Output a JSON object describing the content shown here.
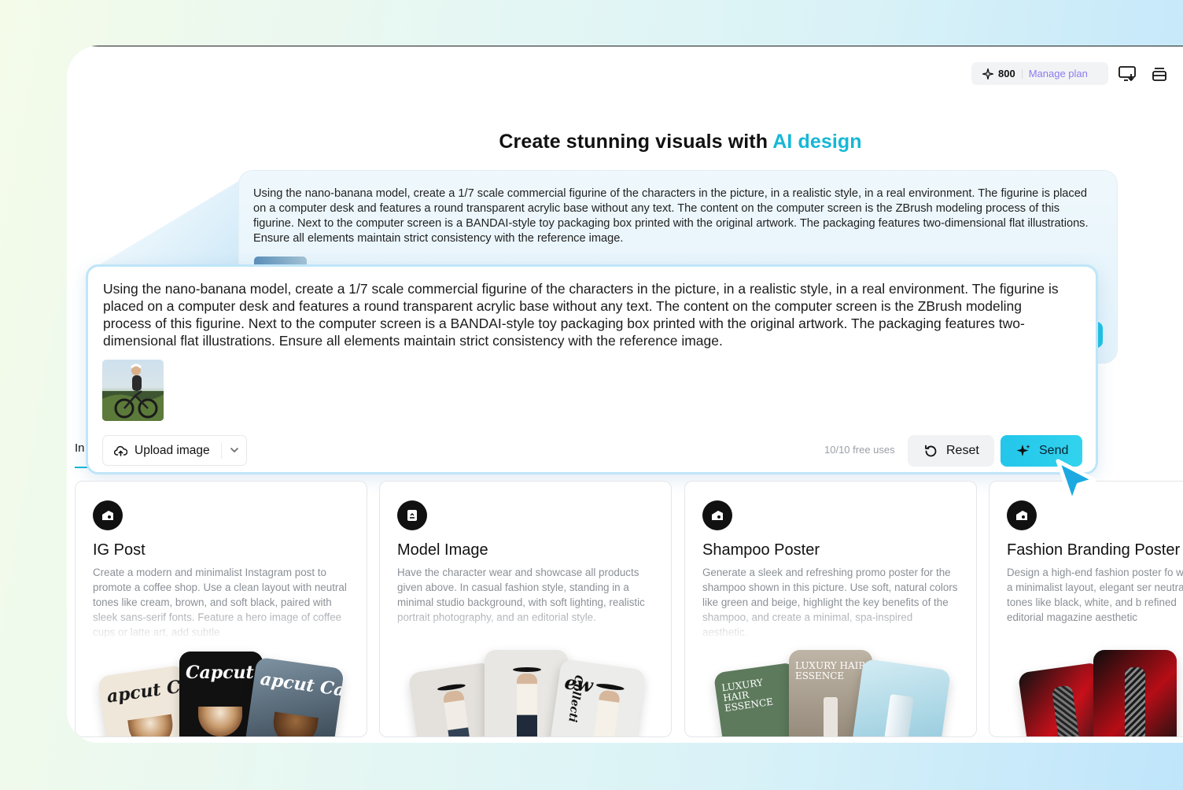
{
  "header": {
    "credits_count": "800",
    "manage_label": "Manage plan"
  },
  "headline": {
    "main": "Create stunning visuals with ",
    "accent": "AI design",
    "accent_color": "#16b7d6"
  },
  "prompt_text": "Using the nano-banana model, create a 1/7 scale commercial figurine of the characters in the picture, in a realistic style, in a real environment. The figurine is placed on a computer desk and features a round transparent acrylic base without any text. The content on the computer screen is the ZBrush modeling process of this figurine. Next to the computer screen is a BANDAI-style toy packaging box printed with the original artwork. The packaging features two-dimensional flat illustrations. Ensure all elements maintain strict consistency with the reference image.",
  "composer": {
    "upload_label": "Upload image",
    "free_uses": "10/10 free uses",
    "reset_label": "Reset",
    "send_label": "Send",
    "send_color": "#23c6ea"
  },
  "tabs": {
    "active_fragment": "In"
  },
  "templates": [
    {
      "title": "IG Post",
      "description": "Create a modern and minimalist Instagram post to promote a coffee shop. Use a clean layout with neutral tones like cream, brown, and soft black, paired with sleek sans-serif fonts. Feature a hero image of coffee cups or latte art, add subtle",
      "previews": [
        "apcut C",
        "Capcut Ca",
        "apcut Caf"
      ]
    },
    {
      "title": "Model Image",
      "description": "Have the character wear and showcase all products given above. In casual fashion style, standing in a minimal studio background, with soft lighting, realistic portrait photography, and an editorial style.",
      "previews": [
        "ew",
        "Collecti"
      ]
    },
    {
      "title": "Shampoo Poster",
      "description": "Generate a sleek and refreshing promo poster for the shampoo shown in this picture. Use soft, natural colors like green and beige, highlight the key benefits of the shampoo, and create a minimal, spa-inspired aesthetic.",
      "previews": [
        "LUXURY HAIR ESSENCE",
        "LUXURY HAIR ESSENCE"
      ]
    },
    {
      "title": "Fashion Branding Poster",
      "description": "Design a high-end fashion poster fo with a minimalist layout, elegant ser neutral tones like black, white, and b refined editorial magazine aesthetic",
      "previews": []
    }
  ]
}
